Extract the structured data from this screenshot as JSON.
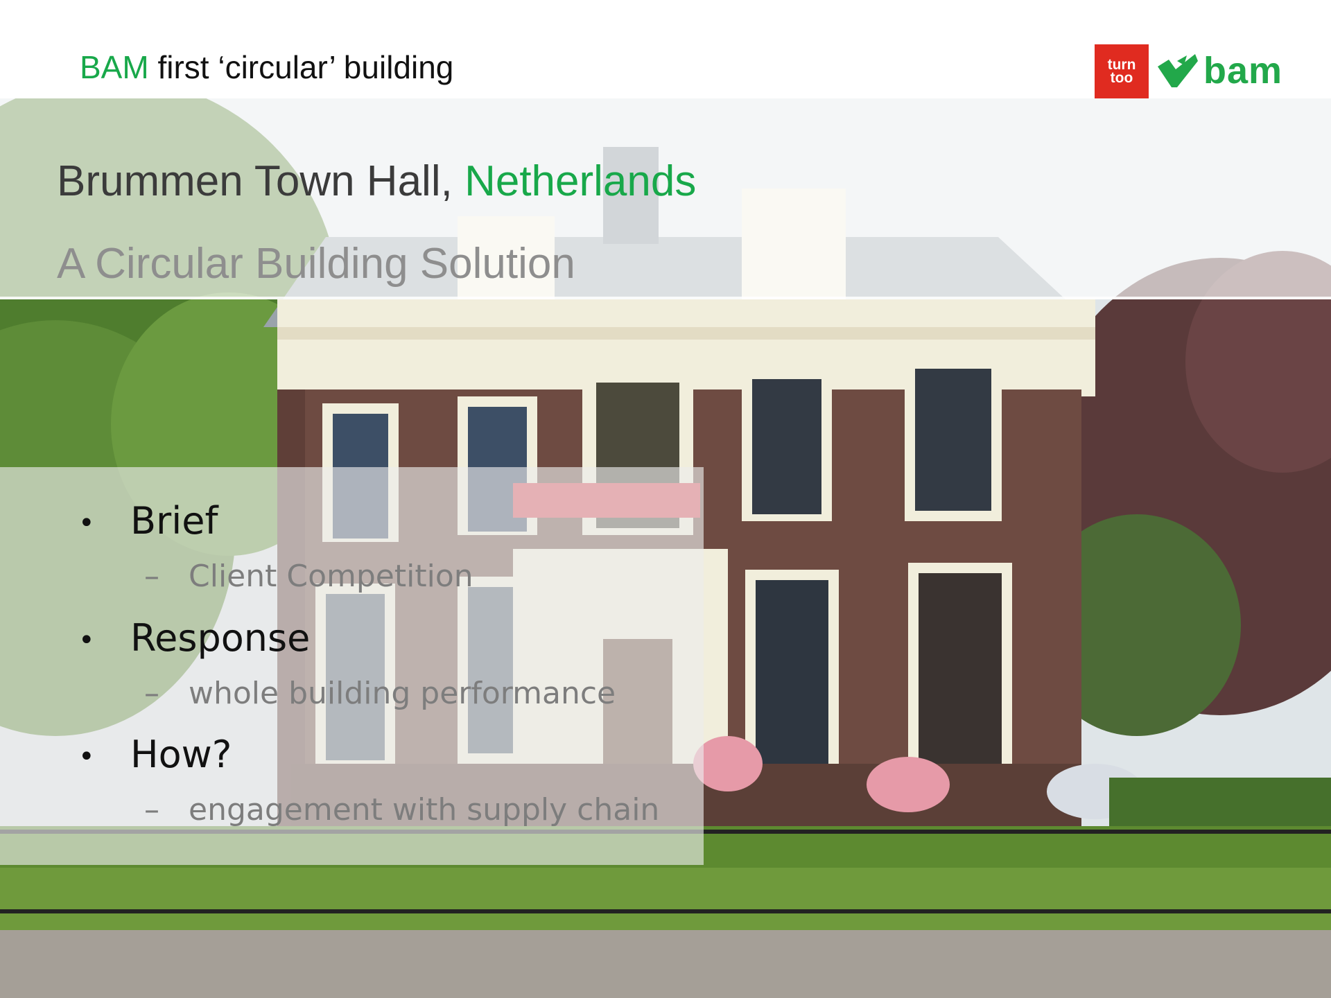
{
  "header": {
    "title_accent": "BAM",
    "title_rest": " first ‘circular’ building"
  },
  "logos": {
    "turntoo_line1": "turn",
    "turntoo_line2": "too",
    "turntoo_color": "#e02b20",
    "bam_word": "bam",
    "bam_color": "#22a84a"
  },
  "headings": {
    "main_prefix": "Brummen Town Hall, ",
    "main_accent": "Netherlands",
    "subtitle": "A Circular Building Solution"
  },
  "bullets": [
    {
      "label": "Brief",
      "sub": "Client Competition"
    },
    {
      "label": "Response",
      "sub": "whole building performance"
    },
    {
      "label": "How?",
      "sub": "engagement with supply chain"
    }
  ],
  "colors": {
    "accent_green": "#18a84a",
    "brick": "#6e4b42",
    "trim": "#f1eedc"
  }
}
